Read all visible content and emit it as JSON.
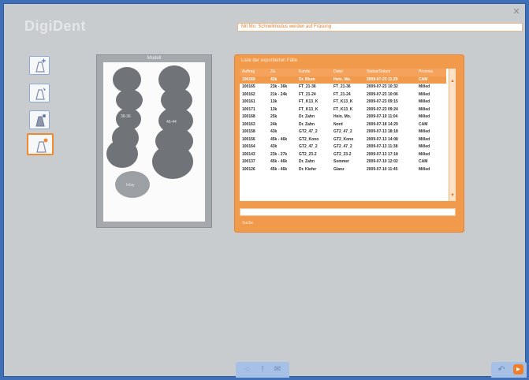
{
  "app": {
    "title": "DigiDent"
  },
  "top_status": {
    "text": "Mit Mo: Schnellmodus werden auf Fräsung"
  },
  "toolbar": {
    "tools": [
      {
        "icon": "crown-add-icon"
      },
      {
        "icon": "crown-edit-icon"
      },
      {
        "icon": "crown-fill-icon"
      },
      {
        "icon": "crown-select-icon",
        "active": true
      }
    ]
  },
  "model": {
    "title": "Modell",
    "labels": [
      "38-36",
      "46-44",
      "Inlay"
    ]
  },
  "orders": {
    "title": "Liste der exportierten Fälle",
    "columns": [
      "Auftrag",
      "Zä.",
      "Kunde",
      "Datei",
      "Status/Datum",
      "Prozess"
    ],
    "rows": [
      [
        "100169",
        "42k",
        "Dr. Blum",
        "Hein. Mo.",
        "2009-07-23 11:29",
        "CAM"
      ],
      [
        "100165",
        "23k - 36k",
        "FT_21-36",
        "FT_21-36",
        "2009-07-23 10:32",
        "Milled"
      ],
      [
        "100162",
        "21k - 24k",
        "FT_21-24",
        "FT_21-24",
        "2009-07-23 10:06",
        "Milled"
      ],
      [
        "100161",
        "13k",
        "FT_K13_K",
        "FT_K13_K",
        "2009-07-23 09:15",
        "Milled"
      ],
      [
        "100171",
        "13k",
        "FT_K13_K",
        "FT_K13_K",
        "2009-07-23 09:24",
        "Milled"
      ],
      [
        "100168",
        "25k",
        "Dr. Zahn",
        "Hein. Mo.",
        "2009-07-19 11:04",
        "Milled"
      ],
      [
        "100163",
        "24k",
        "Dr. Zahn",
        "Nord",
        "2009-07-18 14:29",
        "CAM"
      ],
      [
        "100158",
        "43k",
        "GT2_47_2",
        "GT2_47_2",
        "2009-07-13 18:18",
        "Milled"
      ],
      [
        "100156",
        "45k - 46k",
        "GT2_Kono",
        "GT2_Kono",
        "2009-07-13 14:08",
        "Milled"
      ],
      [
        "100164",
        "43k",
        "GT2_47_2",
        "GT2_47_2",
        "2009-07-13 11:38",
        "Milled"
      ],
      [
        "100143",
        "23k - 27k",
        "GT2_23-2",
        "GT2_23-2",
        "2009-07-13 17:18",
        "Milled"
      ],
      [
        "100137",
        "45k - 46k",
        "Dr. Zahn",
        "Sommer",
        "2009-07-10 12:02",
        "CAM"
      ],
      [
        "100126",
        "45k - 46k",
        "Dr. Kiefer",
        "Glanz",
        "2009-07-10 11:45",
        "Milled"
      ]
    ],
    "filter_value": "",
    "footer": "Suche"
  },
  "bottom_toolbar": {
    "icons": [
      "user-icon",
      "info-icon",
      "mail-icon"
    ],
    "glyphs": [
      "◌",
      "ǃ",
      "✉"
    ]
  },
  "nav": {
    "back_glyph": "↶",
    "next_glyph": "▸"
  },
  "colors": {
    "background": "#c9cccf",
    "accent": "#f19a4c",
    "frame": "#3f6fb6"
  }
}
